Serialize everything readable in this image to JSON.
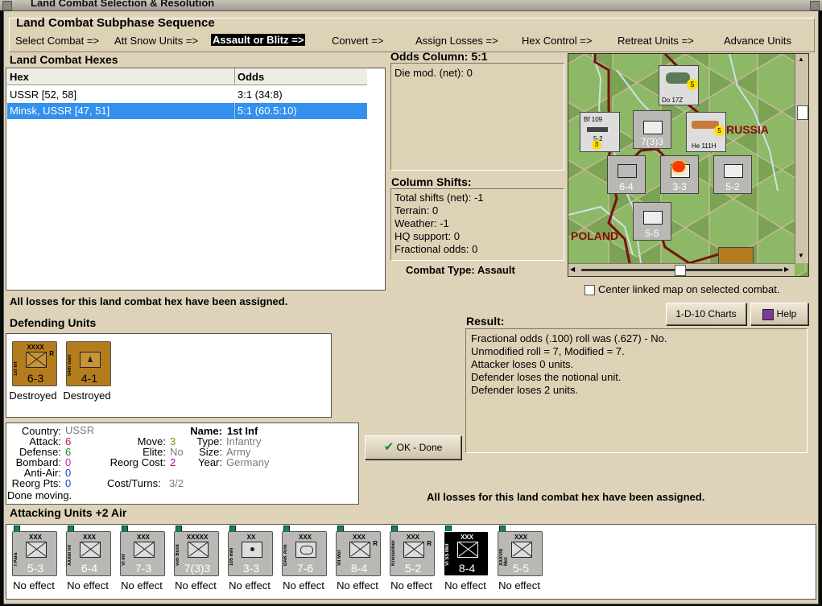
{
  "window": {
    "title": "Land Combat Selection & Resolution"
  },
  "sequence": {
    "title": "Land Combat Subphase Sequence",
    "steps": [
      "Select Combat =>",
      "Att Snow Units =>",
      "Assault or Blitz =>",
      "Convert =>",
      "Assign Losses =>",
      "Hex Control =>",
      "Retreat Units =>",
      "Advance Units"
    ],
    "active_index": 2
  },
  "hexes": {
    "title": "Land Combat Hexes",
    "columns": [
      "Hex",
      "Odds"
    ],
    "rows": [
      {
        "hex": "USSR [52, 58]",
        "odds": "3:1 (34:8)"
      },
      {
        "hex": "Minsk, USSR [47, 51]",
        "odds": "5:1 (60.5:10)"
      }
    ],
    "selected_index": 1
  },
  "odds": {
    "title": "Odds Column: 5:1",
    "die_mod": "Die mod. (net): 0"
  },
  "shifts": {
    "title": "Column Shifts:",
    "lines": [
      "Total shifts (net): -1",
      "Terrain: 0",
      "Weather: -1",
      "HQ support: 0",
      "Fractional odds: 0"
    ]
  },
  "combat_type": "Combat Type:  Assault",
  "map": {
    "labels": [
      "RUSSIA",
      "POLAND"
    ],
    "center_checkbox_label": "Center linked map on selected combat.",
    "center_checked": false,
    "aircraft": [
      {
        "name": "Do 17Z",
        "stats": "3",
        "badge": "5"
      },
      {
        "name": "Bf 109",
        "stats": "5-2",
        "badge": "3"
      },
      {
        "name": "He 111H",
        "stats": "4",
        "badge": "5"
      }
    ],
    "units": [
      "7(3)3",
      "6-4",
      "3-3",
      "5-2",
      "5-5"
    ]
  },
  "buttons": {
    "charts": "1-D-10 Charts",
    "help": "Help",
    "ok": "OK - Done"
  },
  "losses_message": "All losses for this land combat hex have been assigned.",
  "defending": {
    "title": "Defending Units",
    "units": [
      {
        "size": "XXXX",
        "name": "1st Inf",
        "strength": "6-3",
        "extra": "R",
        "type": "inf",
        "effect": "Destroyed"
      },
      {
        "size": "",
        "name": "54th Garr",
        "strength": "4-1",
        "extra": "",
        "type": "garr",
        "effect": "Destroyed"
      }
    ]
  },
  "result": {
    "title": "Result:",
    "lines": [
      "Fractional odds (.100) roll was (.627)  - No.",
      "Unmodified roll = 7, Modified = 7.",
      "Attacker loses 0 units.",
      "Defender loses the notional unit.",
      "Defender loses 2 units."
    ]
  },
  "unit_info": {
    "country_label": "Country:",
    "country": "USSR",
    "attack_label": "Attack:",
    "attack": "6",
    "defense_label": "Defense:",
    "defense": "6",
    "bombard_label": "Bombard:",
    "bombard": "0",
    "antiair_label": "Anti-Air:",
    "antiair": "0",
    "reorgpts_label": "Reorg Pts:",
    "reorgpts": "0",
    "move_label": "Move:",
    "move": "3",
    "elite_label": "Elite:",
    "elite": "No",
    "reorgcost_label": "Reorg Cost:",
    "reorgcost": "2",
    "costturns_label": "Cost/Turns:",
    "costturns": "3/2",
    "name_label": "Name:",
    "name": "1st Inf",
    "type_label": "Type:",
    "type": "Infantry",
    "size_label": "Size:",
    "size": "Army",
    "year_label": "Year:",
    "year": "Germany",
    "status": "Done moving.",
    "colors": {
      "attack": "#c0203a",
      "defense": "#1a8a3a",
      "bombard": "#c020c0",
      "antiair": "#2040c0",
      "reorgpts": "#2040c0",
      "move": "#7a8a10",
      "reorgcost": "#a01090",
      "grey": "#7a7a7a"
    }
  },
  "attacking": {
    "title": "Attacking Units +2 Air",
    "units": [
      {
        "size": "XXX",
        "name": "I Para",
        "strength": "5-3",
        "extra": "",
        "type": "para",
        "style": "grey",
        "effect": "No effect"
      },
      {
        "size": "XXX",
        "name": "XXXIII Inf",
        "strength": "6-4",
        "extra": "",
        "type": "inf",
        "style": "grey",
        "effect": "No effect"
      },
      {
        "size": "XXX",
        "name": "VI Inf",
        "strength": "7-3",
        "extra": "",
        "type": "inf",
        "style": "grey",
        "effect": "No effect"
      },
      {
        "size": "XXXXX",
        "name": "von Bock",
        "strength": "7(3)3",
        "extra": "",
        "type": "inf",
        "style": "grey",
        "effect": "No effect"
      },
      {
        "size": "XX",
        "name": "105 mm",
        "strength": "3-3",
        "extra": "",
        "type": "art",
        "style": "grey",
        "effect": "No effect"
      },
      {
        "size": "XXX",
        "name": "DAK Arm",
        "strength": "7-6",
        "extra": "",
        "type": "arm",
        "style": "grey",
        "effect": "No effect"
      },
      {
        "size": "XXX",
        "name": "VII Mot",
        "strength": "8-4",
        "extra": "R",
        "type": "mot",
        "style": "grey",
        "effect": "No effect"
      },
      {
        "size": "XXX",
        "name": "Kreisenberg",
        "strength": "5-2",
        "extra": "R",
        "type": "mot2",
        "style": "grey",
        "effect": "No effect"
      },
      {
        "size": "XXX",
        "name": "VI SS Mot",
        "strength": "8-4",
        "extra": "",
        "type": "mot",
        "style": "black",
        "effect": "No effect"
      },
      {
        "size": "XXX",
        "name": "XXXVIII Mot",
        "strength": "5-5",
        "extra": "",
        "type": "mot",
        "style": "grey",
        "effect": "No effect"
      }
    ]
  }
}
